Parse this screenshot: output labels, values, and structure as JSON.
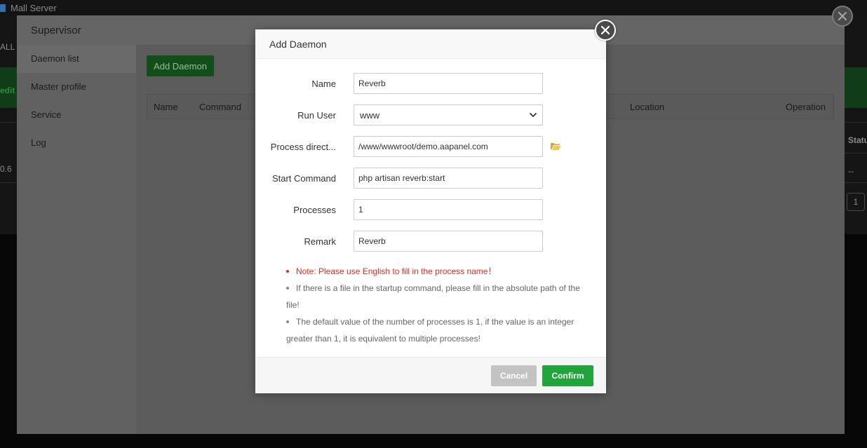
{
  "app": {
    "title": "Mall Server"
  },
  "background": {
    "all_label": "ALL",
    "edit_label": "edit",
    "status_header": "Statu",
    "version_fragment": "0.6",
    "status_value": "--",
    "page_number": "1"
  },
  "supervisor": {
    "title": "Supervisor",
    "sidebar": {
      "items": [
        {
          "label": "Daemon list",
          "active": true
        },
        {
          "label": "Master profile"
        },
        {
          "label": "Service"
        },
        {
          "label": "Log"
        }
      ]
    },
    "add_daemon_label": "Add Daemon",
    "table_headers": [
      "Name",
      "Command",
      "Location",
      "Operation"
    ]
  },
  "modal": {
    "title": "Add Daemon",
    "fields": {
      "name": {
        "label": "Name",
        "value": "Reverb"
      },
      "run_user": {
        "label": "Run User",
        "value": "www"
      },
      "process_dir": {
        "label": "Process direct...",
        "value": "/www/wwwroot/demo.aapanel.com"
      },
      "start_command": {
        "label": "Start Command",
        "value": "php artisan reverb:start"
      },
      "processes": {
        "label": "Processes",
        "value": "1"
      },
      "remark": {
        "label": "Remark",
        "value": "Reverb"
      }
    },
    "notes": [
      "Note: Please use English to fill in the process name！",
      "If there is a file in the startup command, please fill in the absolute path of the file!",
      "The default value of the number of processes is 1, if the value is an integer greater than 1, it is equivalent to multiple processes!"
    ],
    "cancel_label": "Cancel",
    "confirm_label": "Confirm"
  },
  "colors": {
    "accent_green": "#20a53a",
    "note_red": "#e8281e",
    "folder_yellow": "#e8c04a"
  },
  "icons": {
    "modal_close": "close-icon",
    "panel_close": "close-icon",
    "folder": "folder-open-icon",
    "select": "chevron-down-icon"
  }
}
